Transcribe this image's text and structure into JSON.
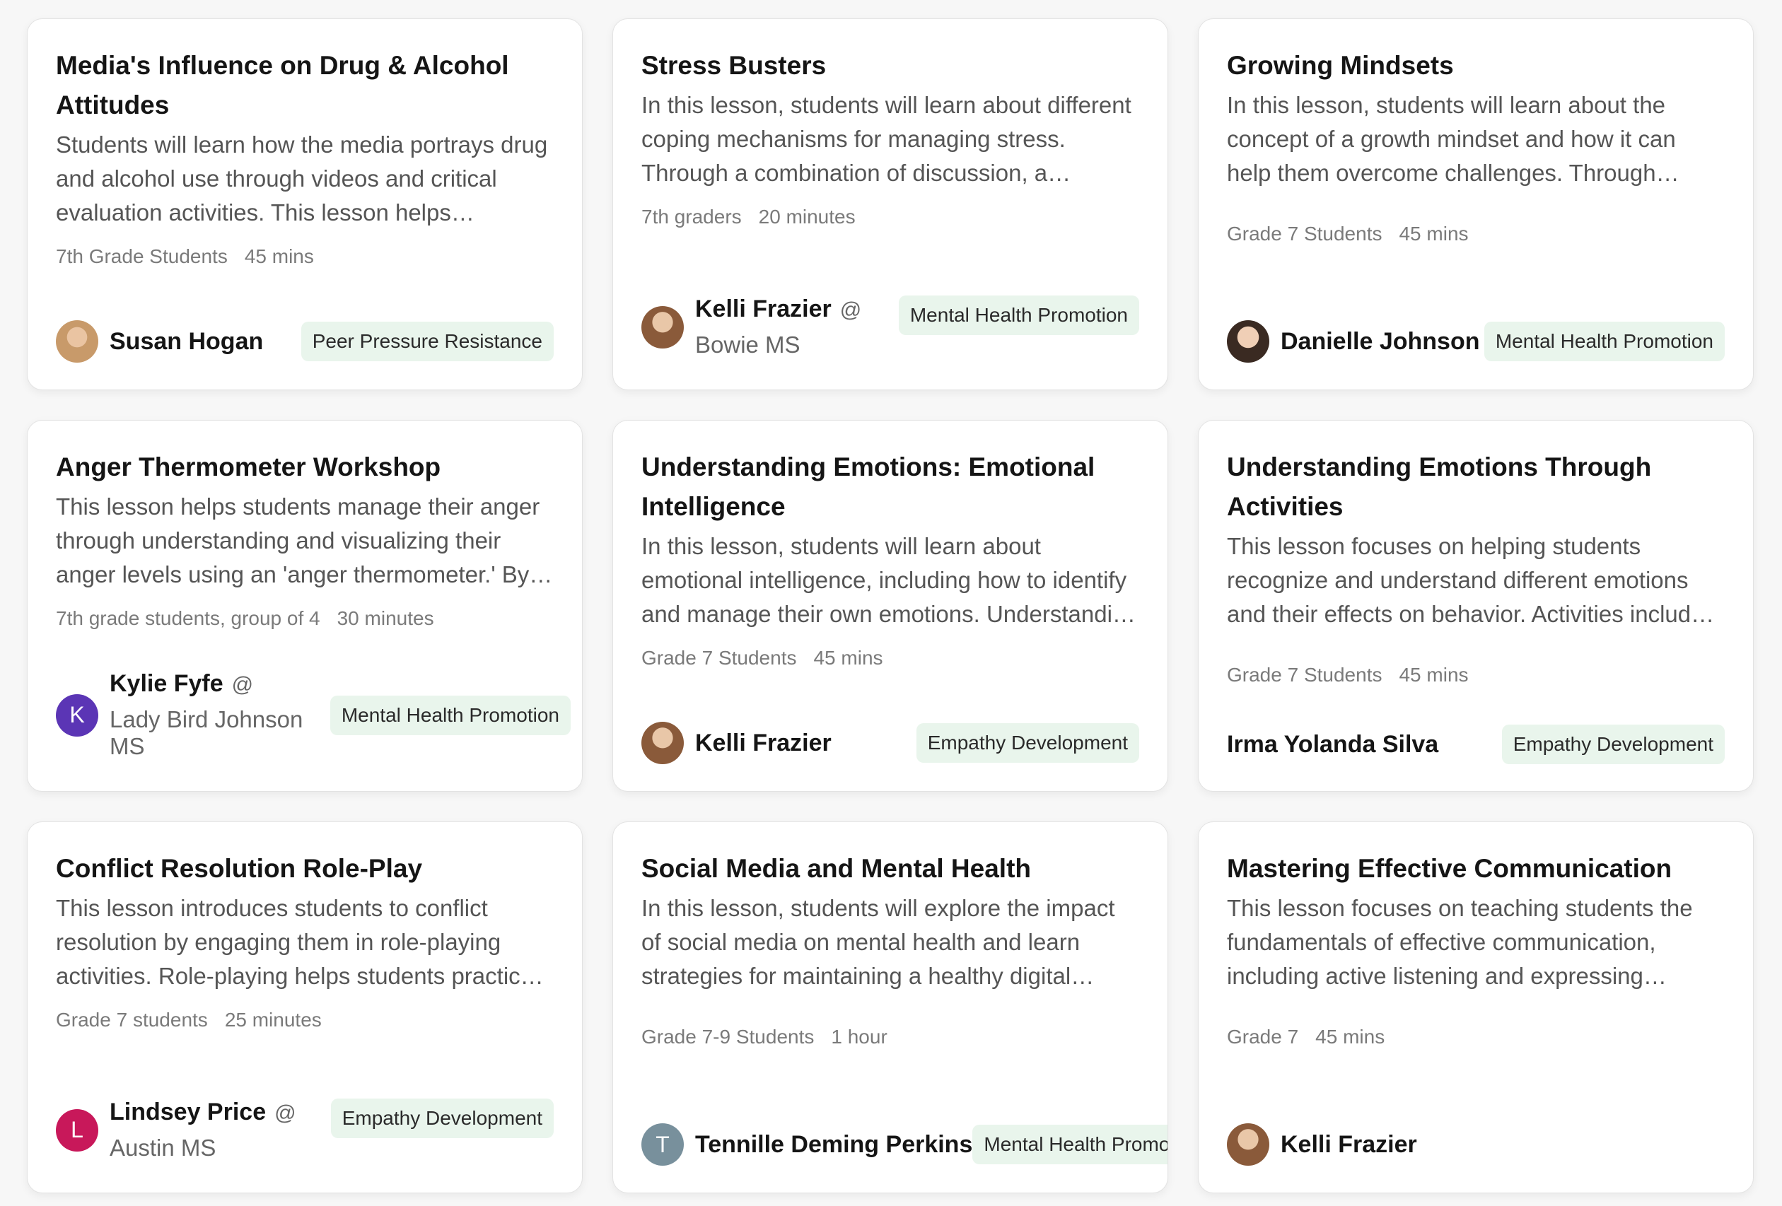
{
  "cards": [
    {
      "title": "Media's Influence on Drug & Alcohol Attitudes",
      "description": "Students will learn how the media portrays drug and alcohol use through videos and critical evaluation activities. This lesson helps students…",
      "audience": "7th Grade Students",
      "duration": "45 mins",
      "author": "Susan Hogan",
      "school": "",
      "tag": "Peer Pressure Resistance",
      "avatar_icon": "user-photo-icon"
    },
    {
      "title": "Stress Busters",
      "description": "In this lesson, students will learn about different coping mechanisms for managing stress. Through a combination of discussion, a collaborative activit…",
      "audience": "7th graders",
      "duration": "20 minutes",
      "author": "Kelli Frazier",
      "school": "Bowie MS",
      "tag": "Mental Health Promotion",
      "avatar_icon": "user-photo-icon"
    },
    {
      "title": "Growing Mindsets",
      "description": "In this lesson, students will learn about the concept of a growth mindset and how it can help them overcome challenges. Through interactive…",
      "audience": "Grade 7 Students",
      "duration": "45 mins",
      "author": "Danielle Johnson",
      "school": "",
      "tag": "Mental Health Promotion",
      "avatar_icon": "user-photo-icon"
    },
    {
      "title": "Anger Thermometer Workshop",
      "description": "This lesson helps students manage their anger through understanding and visualizing their anger levels using an 'anger thermometer.' By…",
      "audience": "7th grade students, group of 4",
      "duration": "30 minutes",
      "author": "Kylie Fyfe",
      "school": "Lady Bird Johnson MS",
      "tag": "Mental Health Promotion",
      "avatar_letter": "K",
      "avatar_color": "#5b35b5"
    },
    {
      "title": "Understanding Emotions: Emotional Intelligence",
      "description": "In this lesson, students will learn about emotional intelligence, including how to identify and manage their own emotions. Understanding and managin…",
      "audience": "Grade 7 Students",
      "duration": "45 mins",
      "author": "Kelli Frazier",
      "school": "",
      "tag": "Empathy Development",
      "avatar_icon": "user-photo-icon"
    },
    {
      "title": "Understanding Emotions Through Activities",
      "description": "This lesson focuses on helping students recognize and understand different emotions and their effects on behavior. Activities include emotion…",
      "audience": "Grade 7 Students",
      "duration": "45 mins",
      "author": "Irma Yolanda Silva",
      "school": "",
      "tag": "Empathy Development"
    },
    {
      "title": "Conflict Resolution Role-Play",
      "description": "This lesson introduces students to conflict resolution by engaging them in role-playing activities. Role-playing helps students practice a…",
      "audience": "Grade 7 students",
      "duration": "25 minutes",
      "author": "Lindsey Price",
      "school": "Austin MS",
      "tag": "Empathy Development",
      "avatar_letter": "L",
      "avatar_color": "#c8185a"
    },
    {
      "title": "Social Media and Mental Health",
      "description": "In this lesson, students will explore the impact of social media on mental health and learn strategies for maintaining a healthy digital presence. This…",
      "audience": "Grade 7-9 Students",
      "duration": "1 hour",
      "author": "Tennille Deming Perkins",
      "school": "",
      "tag": "Mental Health Promotion",
      "avatar_letter": "T",
      "avatar_color": "#78909c"
    },
    {
      "title": "Mastering Effective Communication",
      "description": "This lesson focuses on teaching students the fundamentals of effective communication, including active listening and expressing thought…",
      "audience": "Grade 7",
      "duration": "45 mins",
      "author": "Kelli Frazier",
      "school": "",
      "tag": "",
      "avatar_icon": "user-photo-icon"
    }
  ],
  "at_symbol": "@"
}
